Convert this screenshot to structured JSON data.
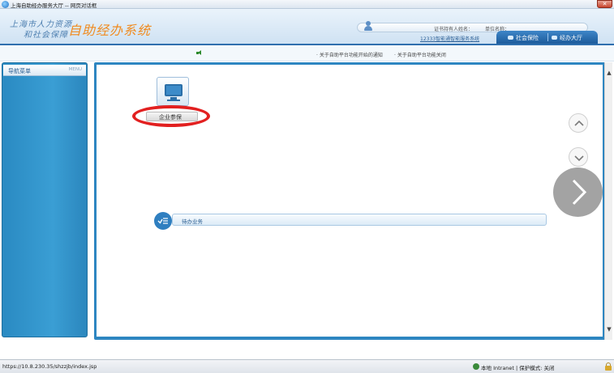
{
  "window": {
    "title": "上海自助经办服务大厅 -- 网页对话框",
    "close_glyph": "✕"
  },
  "header": {
    "logo_line1": "上海市人力资源",
    "logo_line2": "和社会保障",
    "logo_main": "自助经办系统",
    "cert_holder_label": "证书持有人姓名：",
    "unit_name_label": "单位名称：",
    "service_link": "12333智能通智能服务系统",
    "tabs": [
      {
        "label": "社会保险"
      },
      {
        "label": "经办大厅"
      }
    ]
  },
  "notices": {
    "items": [
      "· 关于自助平台功能开始的通知",
      "· 关于自助平台功能关闭"
    ]
  },
  "sidebar": {
    "title": "导航菜单",
    "menu_tag": "MENU"
  },
  "main": {
    "enterprise_tile_label": "企业参保",
    "pending_label": "待办业务"
  },
  "scroll": {
    "up_glyph": "▲",
    "down_glyph": "▼"
  },
  "statusbar": {
    "url": "https://10.8.230.35/shzzjb/index.jsp",
    "zone": "本地 Intranet | 保护模式: 关闭"
  },
  "icons": {
    "browser": "ie-icon",
    "user": "user-icon",
    "speaker": "speaker-icon",
    "monitor": "monitor-icon",
    "checklist": "checklist-icon",
    "chevron_up": "chevron-up-icon",
    "chevron_down": "chevron-down-icon",
    "chevron_right": "chevron-right-icon",
    "lock": "lock-icon"
  },
  "colors": {
    "brand_blue": "#2e86c1",
    "logo_orange": "#f08a1e",
    "highlight_red": "#e22020"
  }
}
